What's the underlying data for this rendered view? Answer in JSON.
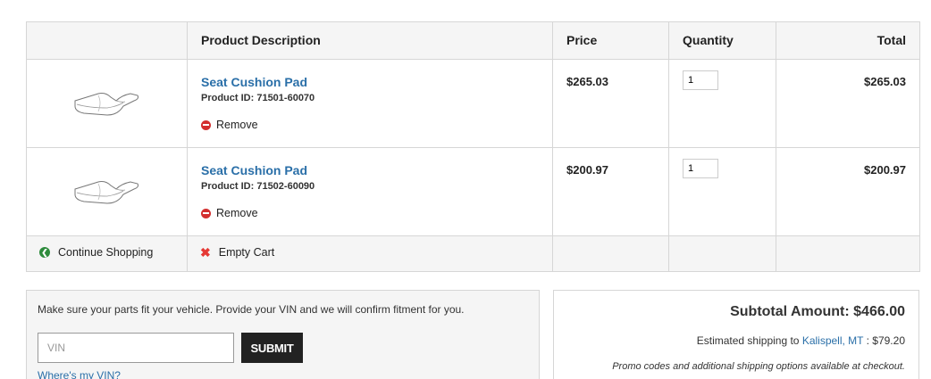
{
  "table": {
    "headers": {
      "image": "",
      "description": "Product Description",
      "price": "Price",
      "quantity": "Quantity",
      "total": "Total"
    },
    "items": [
      {
        "name": "Seat Cushion Pad",
        "product_id": "Product ID: 71501-60070",
        "remove_label": "Remove",
        "price": "$265.03",
        "quantity": "1",
        "total": "$265.03"
      },
      {
        "name": "Seat Cushion Pad",
        "product_id": "Product ID: 71502-60090",
        "remove_label": "Remove",
        "price": "$200.97",
        "quantity": "1",
        "total": "$200.97"
      }
    ],
    "footer": {
      "continue_label": "Continue Shopping",
      "empty_label": "Empty Cart"
    }
  },
  "vin": {
    "message": "Make sure your parts fit your vehicle. Provide your VIN and we will confirm fitment for you.",
    "placeholder": "VIN",
    "submit_label": "SUBMIT",
    "help_link": "Where's my VIN?"
  },
  "summary": {
    "subtotal": "Subtotal Amount: $466.00",
    "shipping_prefix": "Estimated shipping to ",
    "shipping_location": "Kalispell, MT",
    "shipping_suffix": " : $79.20",
    "promo_note": "Promo codes and additional shipping options available at checkout."
  },
  "colors": {
    "link": "#2a6fa8",
    "remove": "#d32f2f",
    "continue": "#2e8b3c",
    "empty": "#e53935",
    "button": "#222222"
  }
}
